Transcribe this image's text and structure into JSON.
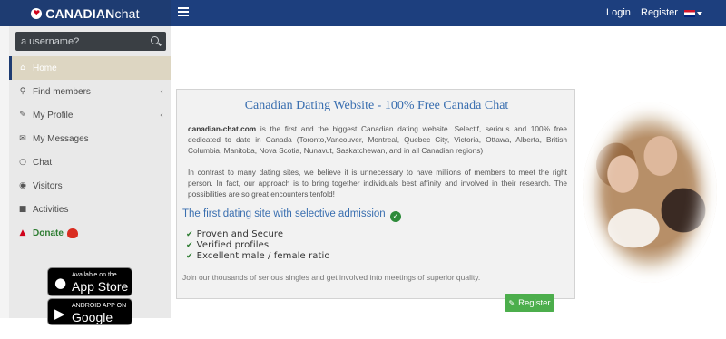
{
  "header": {
    "brand_strong": "CANADIAN",
    "brand_light": "chat",
    "login_label": "Login",
    "register_label": "Register",
    "flag_icon": "uk-flag-icon"
  },
  "sidebar": {
    "search": {
      "placeholder": "a username?"
    },
    "items": [
      {
        "label": "Home",
        "icon": "home-icon"
      },
      {
        "label": "Find members",
        "icon": "search-icon",
        "submenu": true
      },
      {
        "label": "My Profile",
        "icon": "edit-icon",
        "submenu": true
      },
      {
        "label": "My Messages",
        "icon": "envelope-icon"
      },
      {
        "label": "Chat",
        "icon": "chat-bubble-icon"
      },
      {
        "label": "Visitors",
        "icon": "eye-icon"
      },
      {
        "label": "Activities",
        "icon": "folder-icon"
      },
      {
        "label": "Donate",
        "icon": "thumbs-up-icon"
      }
    ],
    "app_store": {
      "small": "Available on the",
      "big": "App Store"
    },
    "google_play": {
      "small": "ANDROID APP ON",
      "big": "Google Play"
    }
  },
  "main": {
    "title": "Canadian Dating Website - 100% Free Canada Chat",
    "p1_strong": "canadian-chat.com",
    "p1_rest": " is the first and the biggest Canadian dating website. Selectif, serious and 100% free dedicated to date in Canada (Toronto,Vancouver, Montreal, Quebec City, Victoria, Ottawa, Alberta, British Columbia, Manitoba, Nova Scotia, Nunavut, Saskatchewan, and in all Canadian regions)",
    "p2": "In contrast to many dating sites, we believe it is unnecessary to have millions of members to meet the right person. In fact, our approach is to bring together individuals best affinity and involved in their research. The possibilities are so great encounters tenfold!",
    "subheading": "The first dating site with selective admission",
    "features": [
      "Proven and Secure",
      "Verified profiles",
      "Excellent male / female ratio"
    ],
    "join_text": "Join our thousands of serious singles and get involved into meetings of superior quality.",
    "register_button": "Register"
  },
  "colors": {
    "header_bg": "#1d3f7e",
    "accent_blue": "#3a6fb0",
    "register_green": "#4cae4c"
  }
}
